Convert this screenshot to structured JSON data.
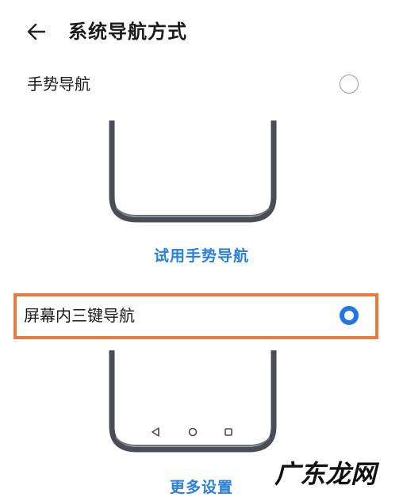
{
  "header": {
    "title": "系统导航方式",
    "back_icon": "arrow-left-icon"
  },
  "options": [
    {
      "label": "手势导航",
      "selected": false,
      "action_label": "试用手势导航"
    },
    {
      "label": "屏幕内三键导航",
      "selected": true,
      "action_label": "更多设置",
      "nav_icons": [
        "triangle-back-icon",
        "circle-home-icon",
        "square-recents-icon"
      ]
    }
  ],
  "colors": {
    "accent": "#2277e5",
    "link": "#2a80d8",
    "highlight": "#ea7a3f",
    "phone_frame": "#4a4d55"
  },
  "watermark": "广东龙网"
}
